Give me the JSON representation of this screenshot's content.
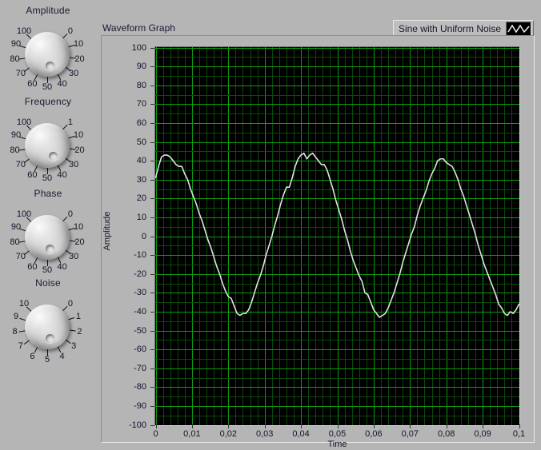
{
  "window": {
    "background": "#b5b5b5"
  },
  "controls": [
    {
      "id": "amplitude",
      "title": "Amplitude",
      "min": 0,
      "max": 100,
      "value": 45,
      "ticks": [
        "0",
        "10",
        "20",
        "30",
        "40",
        "50",
        "60",
        "70",
        "80",
        "90",
        "100"
      ]
    },
    {
      "id": "frequency",
      "title": "Frequency",
      "min": 1,
      "max": 100,
      "value": 40,
      "ticks": [
        "1",
        "10",
        "20",
        "30",
        "40",
        "50",
        "60",
        "70",
        "80",
        "90",
        "100"
      ]
    },
    {
      "id": "phase",
      "title": "Phase",
      "min": 0,
      "max": 100,
      "value": 45,
      "ticks": [
        "0",
        "10",
        "20",
        "30",
        "40",
        "50",
        "60",
        "70",
        "80",
        "90",
        "100"
      ]
    },
    {
      "id": "noise",
      "title": "Noise",
      "min": 0,
      "max": 10,
      "value": 4.5,
      "ticks": [
        "0",
        "1",
        "2",
        "3",
        "4",
        "5",
        "6",
        "7",
        "8",
        "9",
        "10"
      ]
    }
  ],
  "graph": {
    "title": "Waveform Graph",
    "legend": {
      "label": "Sine with Uniform Noise",
      "symbol": "zigzag-line",
      "plot_color": "#e0e0e0",
      "swatch_background": "#000000"
    },
    "plot_background": "#000000",
    "grid_major_color": "#0f9b0f",
    "grid_minor_color": "#0a4a0a"
  },
  "chart_data": {
    "type": "line",
    "title": "Waveform Graph",
    "xlabel": "Time",
    "ylabel": "Amplitude",
    "xlim": [
      0,
      0.1
    ],
    "ylim": [
      -100,
      100
    ],
    "grid": true,
    "legend_position": "top-right",
    "x_ticks": [
      "0",
      "0,01",
      "0,02",
      "0,03",
      "0,04",
      "0,05",
      "0,06",
      "0,07",
      "0,08",
      "0,09",
      "0,1"
    ],
    "x_tick_values": [
      0,
      0.01,
      0.02,
      0.03,
      0.04,
      0.05,
      0.06,
      0.07,
      0.08,
      0.09,
      0.1
    ],
    "y_ticks": [
      "100",
      "90",
      "80",
      "70",
      "60",
      "50",
      "40",
      "30",
      "20",
      "10",
      "0",
      "-10",
      "-20",
      "-30",
      "-40",
      "-50",
      "-60",
      "-70",
      "-80",
      "-90",
      "-100"
    ],
    "y_tick_values": [
      100,
      90,
      80,
      70,
      60,
      50,
      40,
      30,
      20,
      10,
      0,
      -10,
      -20,
      -30,
      -40,
      -50,
      -60,
      -70,
      -80,
      -90,
      -100
    ],
    "series": [
      {
        "name": "Sine with Uniform Noise",
        "color": "#e0e0e0",
        "amplitude": 45,
        "frequency_hz": 40,
        "phase_deg": 45,
        "noise_amplitude": 4.5,
        "x": [
          0,
          0.0008,
          0.0016,
          0.0024,
          0.0032,
          0.004,
          0.0048,
          0.0056,
          0.0064,
          0.0072,
          0.008,
          0.0088,
          0.0096,
          0.0104,
          0.0112,
          0.012,
          0.0128,
          0.0136,
          0.0144,
          0.0152,
          0.016,
          0.0168,
          0.0176,
          0.0184,
          0.0192,
          0.02,
          0.0208,
          0.0216,
          0.0224,
          0.0232,
          0.024,
          0.0248,
          0.0256,
          0.0264,
          0.0272,
          0.028,
          0.0288,
          0.0296,
          0.0304,
          0.0312,
          0.032,
          0.0328,
          0.0336,
          0.0344,
          0.0352,
          0.036,
          0.0368,
          0.0376,
          0.0384,
          0.0392,
          0.04,
          0.0408,
          0.0416,
          0.0424,
          0.0432,
          0.044,
          0.0448,
          0.0456,
          0.0464,
          0.0472,
          0.048,
          0.0488,
          0.0496,
          0.0504,
          0.0512,
          0.052,
          0.0528,
          0.0536,
          0.0544,
          0.0552,
          0.056,
          0.0568,
          0.0576,
          0.0584,
          0.0592,
          0.06,
          0.0608,
          0.0616,
          0.0624,
          0.0632,
          0.064,
          0.0648,
          0.0656,
          0.0664,
          0.0672,
          0.068,
          0.0688,
          0.0696,
          0.0704,
          0.0712,
          0.072,
          0.0728,
          0.0736,
          0.0744,
          0.0752,
          0.076,
          0.0768,
          0.0776,
          0.0784,
          0.0792,
          0.08,
          0.0808,
          0.0816,
          0.0824,
          0.0832,
          0.084,
          0.0848,
          0.0856,
          0.0864,
          0.0872,
          0.088,
          0.0888,
          0.0896,
          0.0904,
          0.0912,
          0.092,
          0.0928,
          0.0936,
          0.0944,
          0.0952,
          0.096,
          0.0968,
          0.0976,
          0.0984,
          0.0992,
          0.1
        ],
        "y": [
          31,
          37,
          42,
          43,
          43,
          42,
          40,
          38,
          37,
          37,
          33,
          30,
          25,
          21,
          17,
          12,
          8,
          3,
          -2,
          -6,
          -11,
          -16,
          -20,
          -25,
          -29,
          -32,
          -33,
          -37,
          -41,
          -42,
          -41,
          -41,
          -39,
          -35,
          -30,
          -25,
          -21,
          -16,
          -10,
          -5,
          0,
          6,
          11,
          17,
          22,
          26,
          26,
          31,
          37,
          41,
          43,
          44,
          41,
          43,
          44,
          42,
          40,
          38,
          38,
          35,
          30,
          25,
          19,
          14,
          9,
          3,
          -2,
          -8,
          -13,
          -17,
          -21,
          -24,
          -30,
          -31,
          -35,
          -39,
          -41,
          -43,
          -42,
          -41,
          -38,
          -34,
          -30,
          -25,
          -20,
          -14,
          -9,
          -4,
          1,
          5,
          11,
          16,
          20,
          24,
          29,
          33,
          36,
          40,
          41,
          41,
          39,
          38,
          37,
          34,
          30,
          25,
          21,
          16,
          11,
          6,
          1,
          -5,
          -10,
          -15,
          -19,
          -23,
          -27,
          -31,
          -36,
          -38,
          -41,
          -42,
          -40,
          -41,
          -39,
          -36
        ]
      }
    ]
  }
}
